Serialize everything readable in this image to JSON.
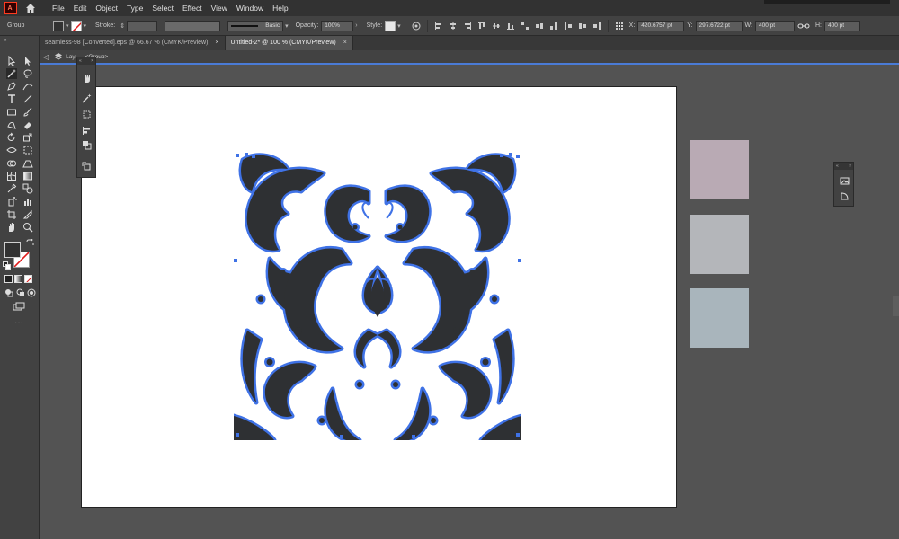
{
  "app": {
    "logo": "Ai"
  },
  "menu": [
    "File",
    "Edit",
    "Object",
    "Type",
    "Select",
    "Effect",
    "View",
    "Window",
    "Help"
  ],
  "control": {
    "selection_type": "Group",
    "stroke_label": "Stroke:",
    "brush_style": "Basic",
    "opacity_label": "Opacity:",
    "opacity_value": "100%",
    "style_label": "Style:",
    "x_label": "X:",
    "x_value": "420.6757 pt",
    "y_label": "Y:",
    "y_value": "297.6722 pt",
    "w_label": "W:",
    "w_value": "400 pt",
    "h_label": "H:",
    "h_value": "400 pt"
  },
  "tabs": [
    {
      "label": "seamless-98 [Converted].eps @ 66.67 % (CMYK/Preview)",
      "close": "×"
    },
    {
      "label": "Untitled-2* @ 100 % (CMYK/Preview)",
      "close": "×"
    }
  ],
  "isolation": {
    "back": "◁",
    "layer": "Lay...",
    "group": "<Group>"
  },
  "colors": {
    "pattern_fill": "#2e3033",
    "pattern_select": "#3f72e6",
    "swatch_1": "#b9aab4",
    "swatch_2": "#b4b6ba",
    "swatch_3": "#a9b5bc"
  },
  "icons": [
    "home-icon",
    "selection-tool-icon",
    "direct-selection-tool-icon",
    "magic-wand-icon",
    "lasso-icon",
    "pen-tool-icon",
    "curvature-icon",
    "type-tool-icon",
    "line-tool-icon",
    "rectangle-tool-icon",
    "paintbrush-icon",
    "shaper-icon",
    "eraser-icon",
    "rotate-icon",
    "scale-icon",
    "width-icon",
    "free-transform-icon",
    "shape-builder-icon",
    "perspective-icon",
    "mesh-icon",
    "gradient-icon",
    "eyedropper-icon",
    "blend-icon",
    "symbol-sprayer-icon",
    "graph-icon",
    "artboard-icon",
    "slice-icon",
    "hand-icon",
    "zoom-icon"
  ]
}
